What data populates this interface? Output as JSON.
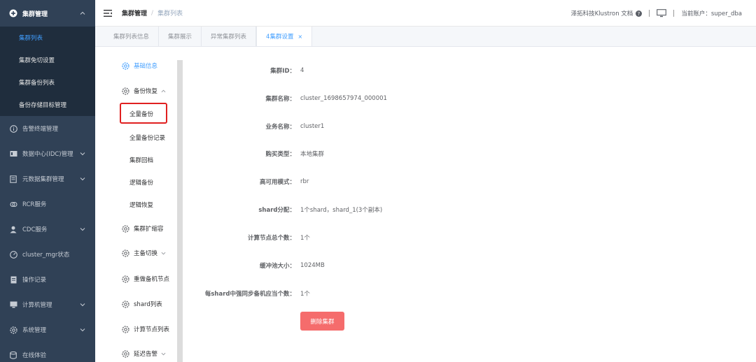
{
  "sidebar": {
    "group_title": "集群管理",
    "sub_items": [
      {
        "label": "集群列表",
        "active": true
      },
      {
        "label": "集群免切设置"
      },
      {
        "label": "集群备份列表"
      },
      {
        "label": "备份存储目标管理"
      }
    ],
    "items": [
      {
        "label": "告警终端管理",
        "icon": "info-circle-icon",
        "has_chevron": false
      },
      {
        "label": "数据中心(IDC)管理",
        "icon": "datacenter-icon",
        "has_chevron": true
      },
      {
        "label": "元数据集群管理",
        "icon": "metadata-icon",
        "has_chevron": true
      },
      {
        "label": "RCR服务",
        "icon": "link-icon",
        "has_chevron": false
      },
      {
        "label": "CDC服务",
        "icon": "user-icon",
        "has_chevron": true
      },
      {
        "label": "cluster_mgr状态",
        "icon": "gauge-icon",
        "has_chevron": false
      },
      {
        "label": "操作记录",
        "icon": "document-icon",
        "has_chevron": false
      },
      {
        "label": "计算机管理",
        "icon": "computer-icon",
        "has_chevron": true
      },
      {
        "label": "系统管理",
        "icon": "gear-icon",
        "has_chevron": true
      },
      {
        "label": "在线体验",
        "icon": "database-icon",
        "has_chevron": false
      }
    ]
  },
  "header": {
    "breadcrumb": [
      "集群管理",
      "集群列表"
    ],
    "docs_label": "泽拓科技Klustron 文档",
    "account_label": "当前账户：super_dba"
  },
  "tabs": [
    {
      "label": "集群列表信息"
    },
    {
      "label": "集群展示"
    },
    {
      "label": "异常集群列表"
    },
    {
      "label": "4集群设置",
      "active": true,
      "closable": "×"
    }
  ],
  "submenu": {
    "items": [
      {
        "label": "基础信息",
        "blue": true
      },
      {
        "label": "备份恢复",
        "chevron": "up"
      },
      {
        "label": "集群扩缩容"
      },
      {
        "label": "主备切换",
        "chevron": "down"
      },
      {
        "label": "重做备机节点"
      },
      {
        "label": "shard列表"
      },
      {
        "label": "计算节点列表"
      },
      {
        "label": "延迟告警",
        "chevron": "down"
      }
    ],
    "children": [
      "全量备份",
      "全量备份记录",
      "集群回档",
      "逻辑备份",
      "逻辑恢复"
    ]
  },
  "detail": {
    "rows": [
      {
        "label": "集群ID：",
        "value": "4"
      },
      {
        "label": "集群名称：",
        "value": "cluster_1698657974_000001"
      },
      {
        "label": "业务名称：",
        "value": "cluster1"
      },
      {
        "label": "购买类型：",
        "value": "本地集群"
      },
      {
        "label": "高可用模式：",
        "value": "rbr"
      },
      {
        "label": "shard分配：",
        "value": "1个shard，shard_1(3个副本)"
      },
      {
        "label": "计算节点总个数：",
        "value": "1个"
      },
      {
        "label": "缓冲池大小：",
        "value": "1024MB"
      },
      {
        "label": "每shard中强同步备机应当个数：",
        "value": "1个"
      }
    ],
    "delete_label": "删除集群"
  },
  "colors": {
    "sidebar_bg": "#304156",
    "sidebar_sub_bg": "#1f2d3d",
    "accent": "#409eff",
    "danger": "#f56c6c",
    "highlight": "#e02020"
  }
}
